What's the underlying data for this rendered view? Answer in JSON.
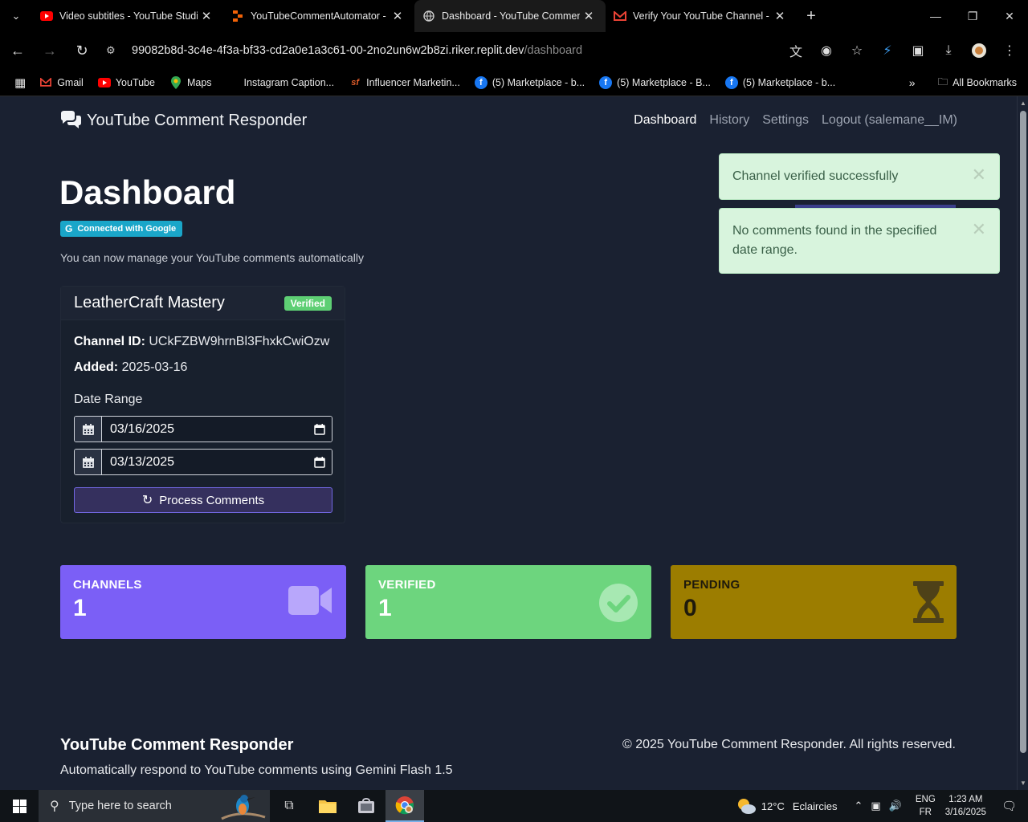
{
  "browser": {
    "tabs": [
      {
        "title": "Video subtitles - YouTube Studio",
        "icon": "youtube-icon"
      },
      {
        "title": "YouTubeCommentAutomator - Replit",
        "icon": "replit-icon"
      },
      {
        "title": "Dashboard - YouTube Comment Responder",
        "icon": "globe-icon"
      },
      {
        "title": "Verify Your YouTube Channel - Gmail",
        "icon": "gmail-icon"
      }
    ],
    "url_host": "99082b8d-3c4e-4f3a-bf33-cd2a0e1a3c61-00-2no2un6w2b8zi.riker.replit.dev",
    "url_path": "/dashboard",
    "bookmarks": [
      {
        "label": "Gmail",
        "icon": "gmail-icon"
      },
      {
        "label": "YouTube",
        "icon": "youtube-icon"
      },
      {
        "label": "Maps",
        "icon": "maps-icon"
      },
      {
        "label": "Instagram Caption...",
        "icon": "page-icon"
      },
      {
        "label": "Influencer Marketin...",
        "icon": "sf-icon"
      },
      {
        "label": "(5) Marketplace - b...",
        "icon": "facebook-icon"
      },
      {
        "label": "(5) Marketplace - B...",
        "icon": "facebook-icon"
      },
      {
        "label": "(5) Marketplace - b...",
        "icon": "facebook-icon"
      }
    ],
    "all_bookmarks": "All Bookmarks"
  },
  "app": {
    "brand": "YouTube Comment Responder",
    "nav": {
      "dashboard": "Dashboard",
      "history": "History",
      "settings": "Settings",
      "logout": "Logout (salemane__IM)"
    },
    "title": "Dashboard",
    "google_badge": "Connected with Google",
    "subtitle": "You can now manage your YouTube comments automatically",
    "channel": {
      "name": "LeatherCraft Mastery",
      "status": "Verified",
      "id_label": "Channel ID:",
      "id_value": "UCkFZBW9hrnBl3FhxkCwiOzw",
      "added_label": "Added:",
      "added_value": "2025-03-16",
      "date_range_label": "Date Range",
      "start_date": "03/16/2025",
      "end_date": "03/13/2025",
      "process_label": "Process Comments"
    },
    "toasts": [
      {
        "message": "Channel verified successfully"
      },
      {
        "message": "No comments found in the specified date range."
      }
    ],
    "stats": [
      {
        "label": "CHANNELS",
        "value": "1",
        "icon": "video-camera-icon",
        "color": "#7b5ff6"
      },
      {
        "label": "VERIFIED",
        "value": "1",
        "icon": "check-circle-icon",
        "color": "#6dd57e"
      },
      {
        "label": "PENDING",
        "value": "0",
        "icon": "hourglass-icon",
        "color": "#9c7d00"
      }
    ],
    "footer": {
      "title": "YouTube Comment Responder",
      "subtitle": "Automatically respond to YouTube comments using Gemini Flash 1.5",
      "copyright": "© 2025 YouTube Comment Responder. All rights reserved."
    }
  },
  "taskbar": {
    "search_placeholder": "Type here to search",
    "weather_temp": "12°C",
    "weather_desc": "Eclaircies",
    "lang_1": "ENG",
    "lang_2": "FR",
    "time": "1:23 AM",
    "date": "3/16/2025"
  }
}
